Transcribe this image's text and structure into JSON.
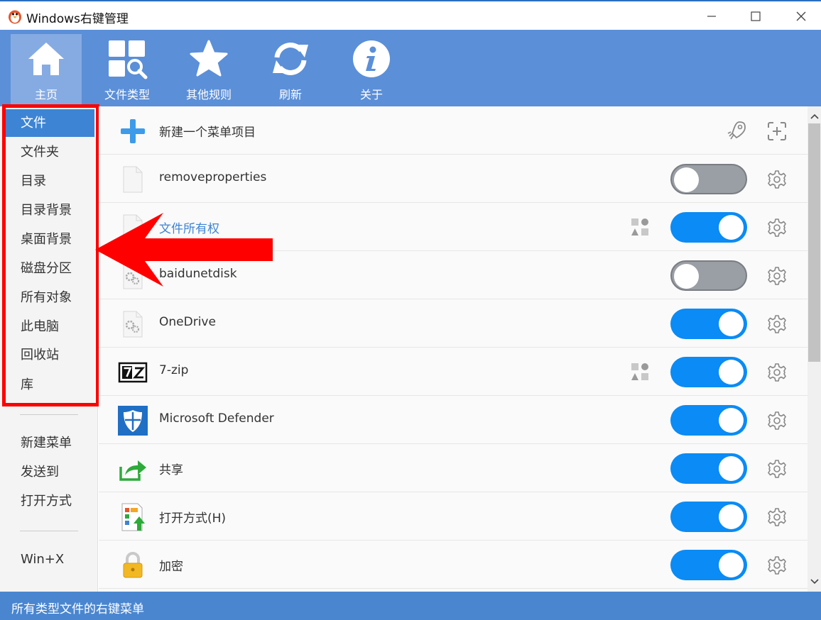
{
  "window": {
    "title": "Windows右键管理",
    "app_icon": "penguin-icon",
    "controls": [
      "minimize-icon",
      "maximize-icon",
      "close-icon"
    ]
  },
  "toolbar": {
    "items": [
      {
        "label": "主页",
        "icon": "home-icon",
        "active": true
      },
      {
        "label": "文件类型",
        "icon": "grid-search-icon",
        "active": false
      },
      {
        "label": "其他规则",
        "icon": "star-icon",
        "active": false
      },
      {
        "label": "刷新",
        "icon": "refresh-icon",
        "active": false
      },
      {
        "label": "关于",
        "icon": "info-icon",
        "active": false
      }
    ]
  },
  "sidebar": {
    "items": [
      {
        "label": "文件",
        "selected": true
      },
      {
        "label": "文件夹"
      },
      {
        "label": "目录"
      },
      {
        "label": "目录背景"
      },
      {
        "label": "桌面背景"
      },
      {
        "label": "磁盘分区"
      },
      {
        "label": "所有对象"
      },
      {
        "label": "此电脑"
      },
      {
        "label": "回收站"
      },
      {
        "label": "库"
      },
      {
        "label": "新建菜单"
      },
      {
        "label": "发送到"
      },
      {
        "label": "打开方式"
      },
      {
        "label": "Win+X"
      }
    ]
  },
  "main": {
    "new_item": {
      "label": "新建一个菜单项目",
      "icon": "plus-icon",
      "actions": [
        "rocket-icon",
        "add-crosshair-icon"
      ]
    },
    "rows": [
      {
        "label": "removeproperties",
        "icon": "blank-file-icon",
        "enabled": false,
        "shapes_icon": false
      },
      {
        "label": "文件所有权",
        "icon": "blank-file-icon",
        "enabled": true,
        "shapes_icon": true,
        "link": true
      },
      {
        "label": "baidunetdisk",
        "icon": "gear-file-icon",
        "enabled": false,
        "shapes_icon": false
      },
      {
        "label": "OneDrive",
        "icon": "gear-file-icon",
        "enabled": true,
        "shapes_icon": false
      },
      {
        "label": "7-zip",
        "icon": "7zip-icon",
        "enabled": true,
        "shapes_icon": true
      },
      {
        "label": "Microsoft Defender",
        "icon": "shield-icon",
        "enabled": true,
        "shapes_icon": false
      },
      {
        "label": "共享",
        "icon": "share-arrow-icon",
        "enabled": true,
        "shapes_icon": false
      },
      {
        "label": "打开方式(H)",
        "icon": "open-with-icon",
        "enabled": true,
        "shapes_icon": false
      },
      {
        "label": "加密",
        "icon": "lock-icon",
        "enabled": true,
        "shapes_icon": false
      }
    ]
  },
  "statusbar": {
    "text": "所有类型文件的右键菜单"
  },
  "colors": {
    "toolbar_bg": "#5b8fd8",
    "accent": "#3d85d4",
    "toggle_on": "#0a8bf5",
    "toggle_off": "#9a9ea5",
    "annotation": "#ff0000"
  }
}
